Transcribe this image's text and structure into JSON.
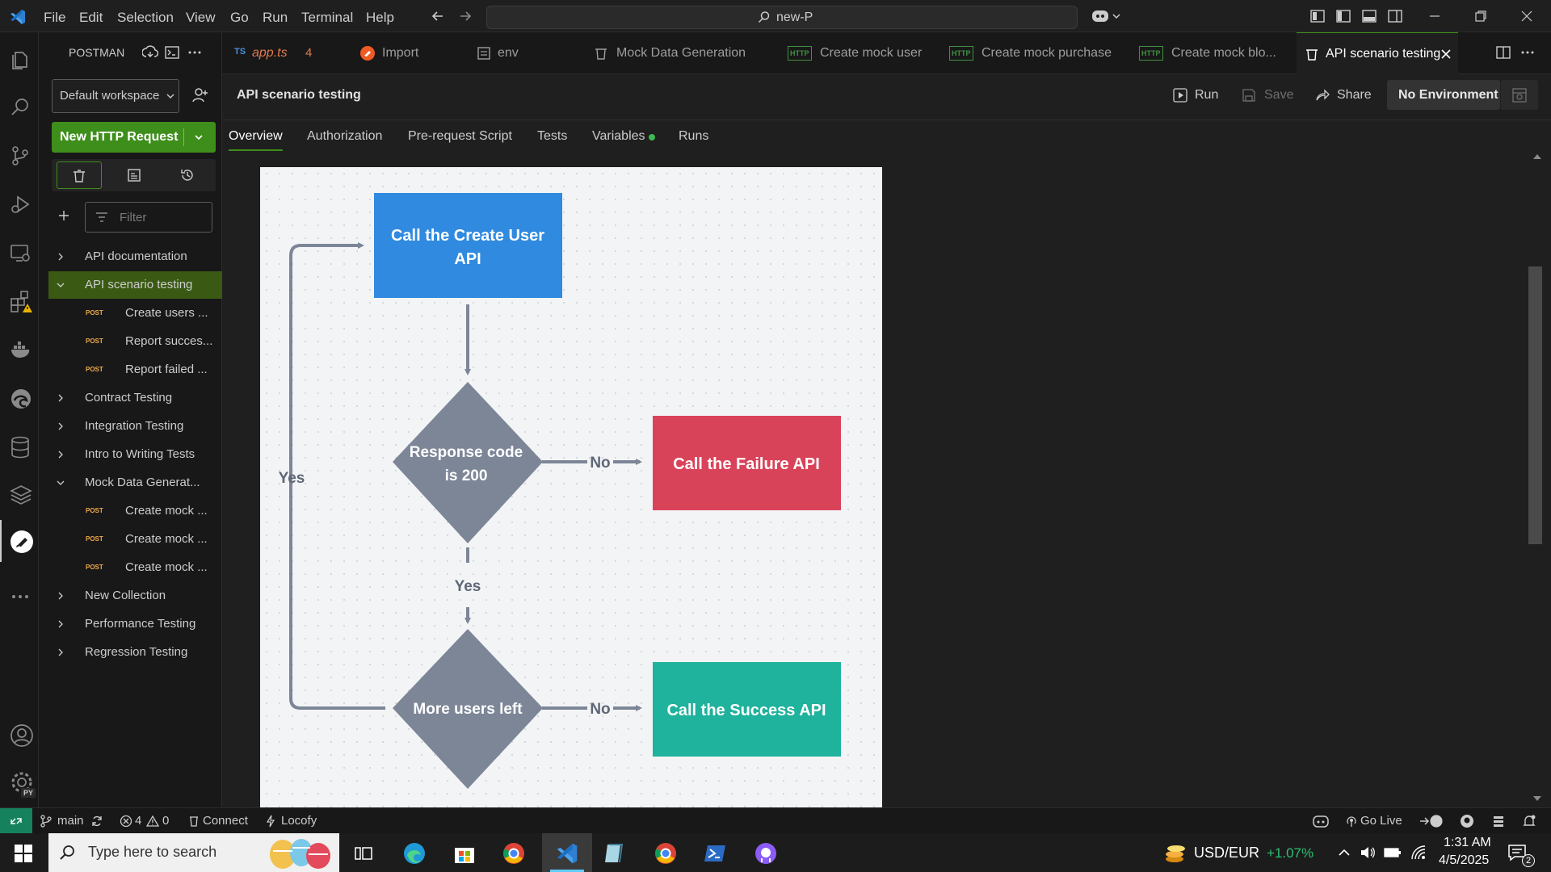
{
  "titlebar": {
    "menus": [
      "File",
      "Edit",
      "Selection",
      "View",
      "Go",
      "Run",
      "Terminal",
      "Help"
    ],
    "search_text": "new-P"
  },
  "sidebar": {
    "title": "POSTMAN",
    "workspace": "Default workspace",
    "new_request": "New HTTP Request",
    "filter_placeholder": "Filter",
    "items": [
      {
        "label": "API documentation",
        "expanded": false
      },
      {
        "label": "API scenario testing",
        "expanded": true,
        "selected": true
      },
      {
        "label": "Create users ...",
        "method": "POST"
      },
      {
        "label": "Report succes...",
        "method": "POST"
      },
      {
        "label": "Report failed ...",
        "method": "POST"
      },
      {
        "label": "Contract Testing",
        "expanded": false
      },
      {
        "label": "Integration Testing",
        "expanded": false
      },
      {
        "label": "Intro to Writing Tests",
        "expanded": false
      },
      {
        "label": "Mock Data Generat...",
        "expanded": true
      },
      {
        "label": "Create mock ...",
        "method": "POST"
      },
      {
        "label": "Create mock ...",
        "method": "POST"
      },
      {
        "label": "Create mock ...",
        "method": "POST"
      },
      {
        "label": "New Collection",
        "expanded": false
      },
      {
        "label": "Performance Testing",
        "expanded": false
      },
      {
        "label": "Regression Testing",
        "expanded": false
      }
    ]
  },
  "tabs": [
    {
      "icon": "TS",
      "label": "app.ts",
      "badge": "4"
    },
    {
      "label": "Import"
    },
    {
      "label": "env"
    },
    {
      "label": "Mock Data Generation"
    },
    {
      "label": "Create mock user"
    },
    {
      "label": "Create mock purchase"
    },
    {
      "label": "Create mock blo..."
    },
    {
      "label": "API scenario testing",
      "active": true
    }
  ],
  "editor": {
    "title": "API scenario testing",
    "run": "Run",
    "save": "Save",
    "share": "Share",
    "environment": "No Environment",
    "subtabs": [
      "Overview",
      "Authorization",
      "Pre-request Script",
      "Tests",
      "Variables",
      "Runs"
    ]
  },
  "diagram": {
    "create_user": [
      "Call the Create User",
      "API"
    ],
    "response_code": [
      "Response code",
      "is 200"
    ],
    "failure": "Call the Failure API",
    "more_users": "More users left",
    "success": "Call the Success API",
    "no_label": "No",
    "yes_label": "Yes",
    "colors": {
      "blue": "#2f8ae0",
      "red": "#d9435a",
      "teal": "#1fb29c",
      "gray": "#7c8697",
      "line": "#7c8697"
    }
  },
  "status": {
    "branch": "main",
    "errors": "4",
    "warnings": "0",
    "connect": "Connect",
    "locofy": "Locofy",
    "golive": "Go Live"
  },
  "taskbar": {
    "search_placeholder": "Type here to search",
    "currency": "USD/EUR",
    "change": "+1.07%",
    "time": "1:31 AM",
    "date": "4/5/2025",
    "notifications": "2"
  }
}
